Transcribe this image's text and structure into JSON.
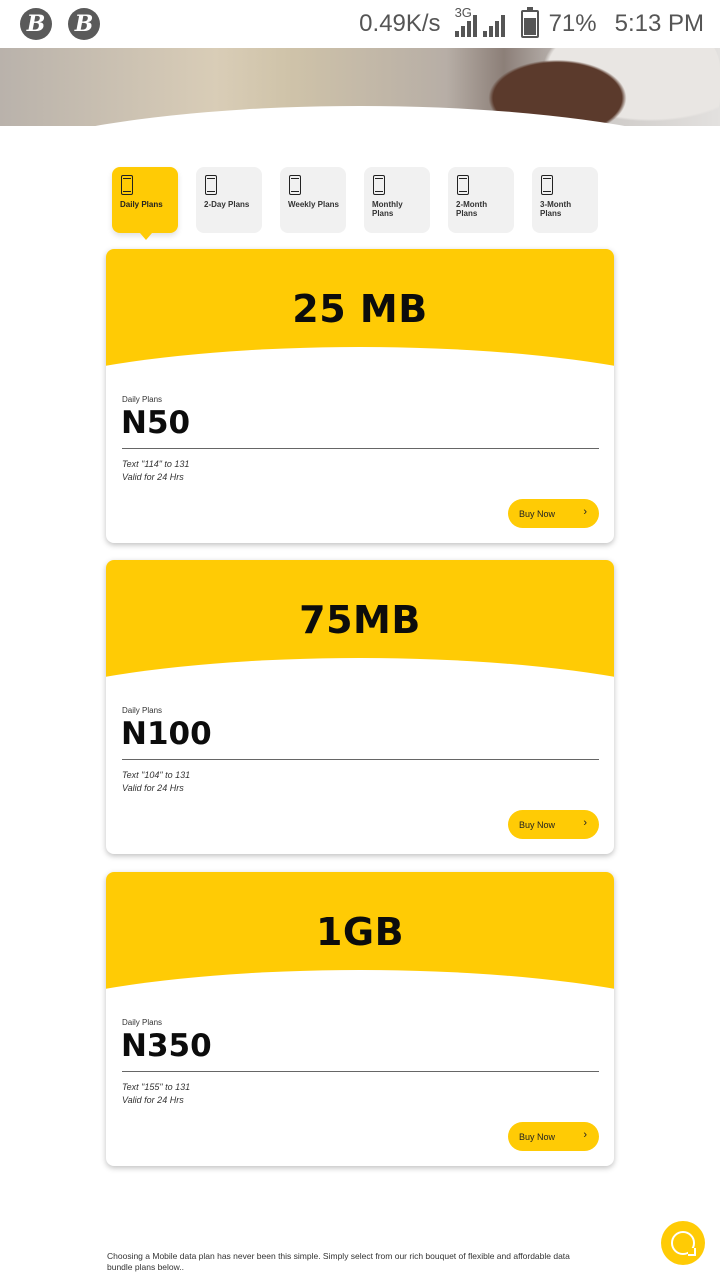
{
  "status_bar": {
    "app_icons": [
      "B",
      "B"
    ],
    "net_speed": "0.49K/s",
    "network_type": "3G",
    "battery": "71%",
    "battery_level": 0.71,
    "time": "5:13 PM"
  },
  "tabs": [
    {
      "label": "Daily Plans",
      "active": true
    },
    {
      "label": "2-Day Plans",
      "active": false
    },
    {
      "label": "Weekly Plans",
      "active": false
    },
    {
      "label": "Monthly Plans",
      "active": false
    },
    {
      "label": "2-Month Plans",
      "active": false
    },
    {
      "label": "3-Month Plans",
      "active": false
    }
  ],
  "plans": [
    {
      "size": "25 MB",
      "category": "Daily Plans",
      "price": "N50",
      "text": "Text \"114\" to 131",
      "validity": "Valid for 24 Hrs",
      "button": "Buy Now"
    },
    {
      "size": "75MB",
      "category": "Daily Plans",
      "price": "N100",
      "text": "Text \"104\" to 131",
      "validity": "Valid for 24 Hrs",
      "button": "Buy Now"
    },
    {
      "size": "1GB",
      "category": "Daily Plans",
      "price": "N350",
      "text": "Text \"155\" to 131",
      "validity": "Valid for 24 Hrs",
      "button": "Buy Now"
    }
  ],
  "footer": {
    "description": "Choosing a Mobile data plan has never been this simple. Simply select from our rich bouquet of flexible and affordable data bundle plans below.."
  },
  "colors": {
    "accent": "#ffcb05"
  }
}
